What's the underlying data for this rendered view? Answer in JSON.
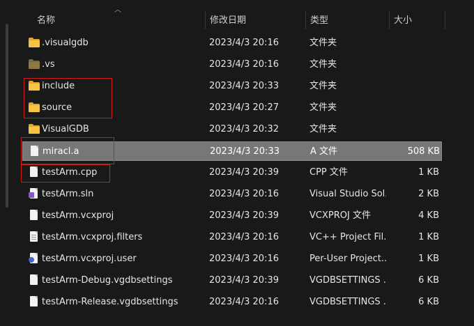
{
  "columns": {
    "name": "名称",
    "date": "修改日期",
    "type": "类型",
    "size": "大小"
  },
  "files": [
    {
      "name": ".visualgdb",
      "date": "2023/4/3 20:16",
      "type": "文件夹",
      "size": "",
      "icon": "folder-icon"
    },
    {
      "name": ".vs",
      "date": "2023/4/3 20:16",
      "type": "文件夹",
      "size": "",
      "icon": "folder-icon"
    },
    {
      "name": "include",
      "date": "2023/4/3 20:33",
      "type": "文件夹",
      "size": "",
      "icon": "folder-icon"
    },
    {
      "name": "source",
      "date": "2023/4/3 20:27",
      "type": "文件夹",
      "size": "",
      "icon": "folder-icon"
    },
    {
      "name": "VisualGDB",
      "date": "2023/4/3 20:32",
      "type": "文件夹",
      "size": "",
      "icon": "folder-icon"
    },
    {
      "name": "miracl.a",
      "date": "2023/4/3 20:33",
      "type": "A 文件",
      "size": "508 KB",
      "icon": "file-icon"
    },
    {
      "name": "testArm.cpp",
      "date": "2023/4/3 20:39",
      "type": "CPP 文件",
      "size": "1 KB",
      "icon": "file-icon"
    },
    {
      "name": "testArm.sln",
      "date": "2023/4/3 20:16",
      "type": "Visual Studio Sol...",
      "size": "2 KB",
      "icon": "solution-file-icon"
    },
    {
      "name": "testArm.vcxproj",
      "date": "2023/4/3 20:39",
      "type": "VCXPROJ 文件",
      "size": "4 KB",
      "icon": "file-icon"
    },
    {
      "name": "testArm.vcxproj.filters",
      "date": "2023/4/3 20:16",
      "type": "VC++ Project Fil...",
      "size": "1 KB",
      "icon": "filters-file-icon"
    },
    {
      "name": "testArm.vcxproj.user",
      "date": "2023/4/3 20:16",
      "type": "Per-User Project...",
      "size": "1 KB",
      "icon": "user-file-icon"
    },
    {
      "name": "testArm-Debug.vgdbsettings",
      "date": "2023/4/3 20:39",
      "type": "VGDBSETTINGS ...",
      "size": "6 KB",
      "icon": "file-icon"
    },
    {
      "name": "testArm-Release.vgdbsettings",
      "date": "2023/4/3 20:16",
      "type": "VGDBSETTINGS ...",
      "size": "6 KB",
      "icon": "file-icon"
    }
  ],
  "selected_file": "miracl.a",
  "colors": {
    "background": "#191919",
    "selection": "#777777",
    "highlight_box": "#d11a1a",
    "folder": "#f5c443"
  }
}
